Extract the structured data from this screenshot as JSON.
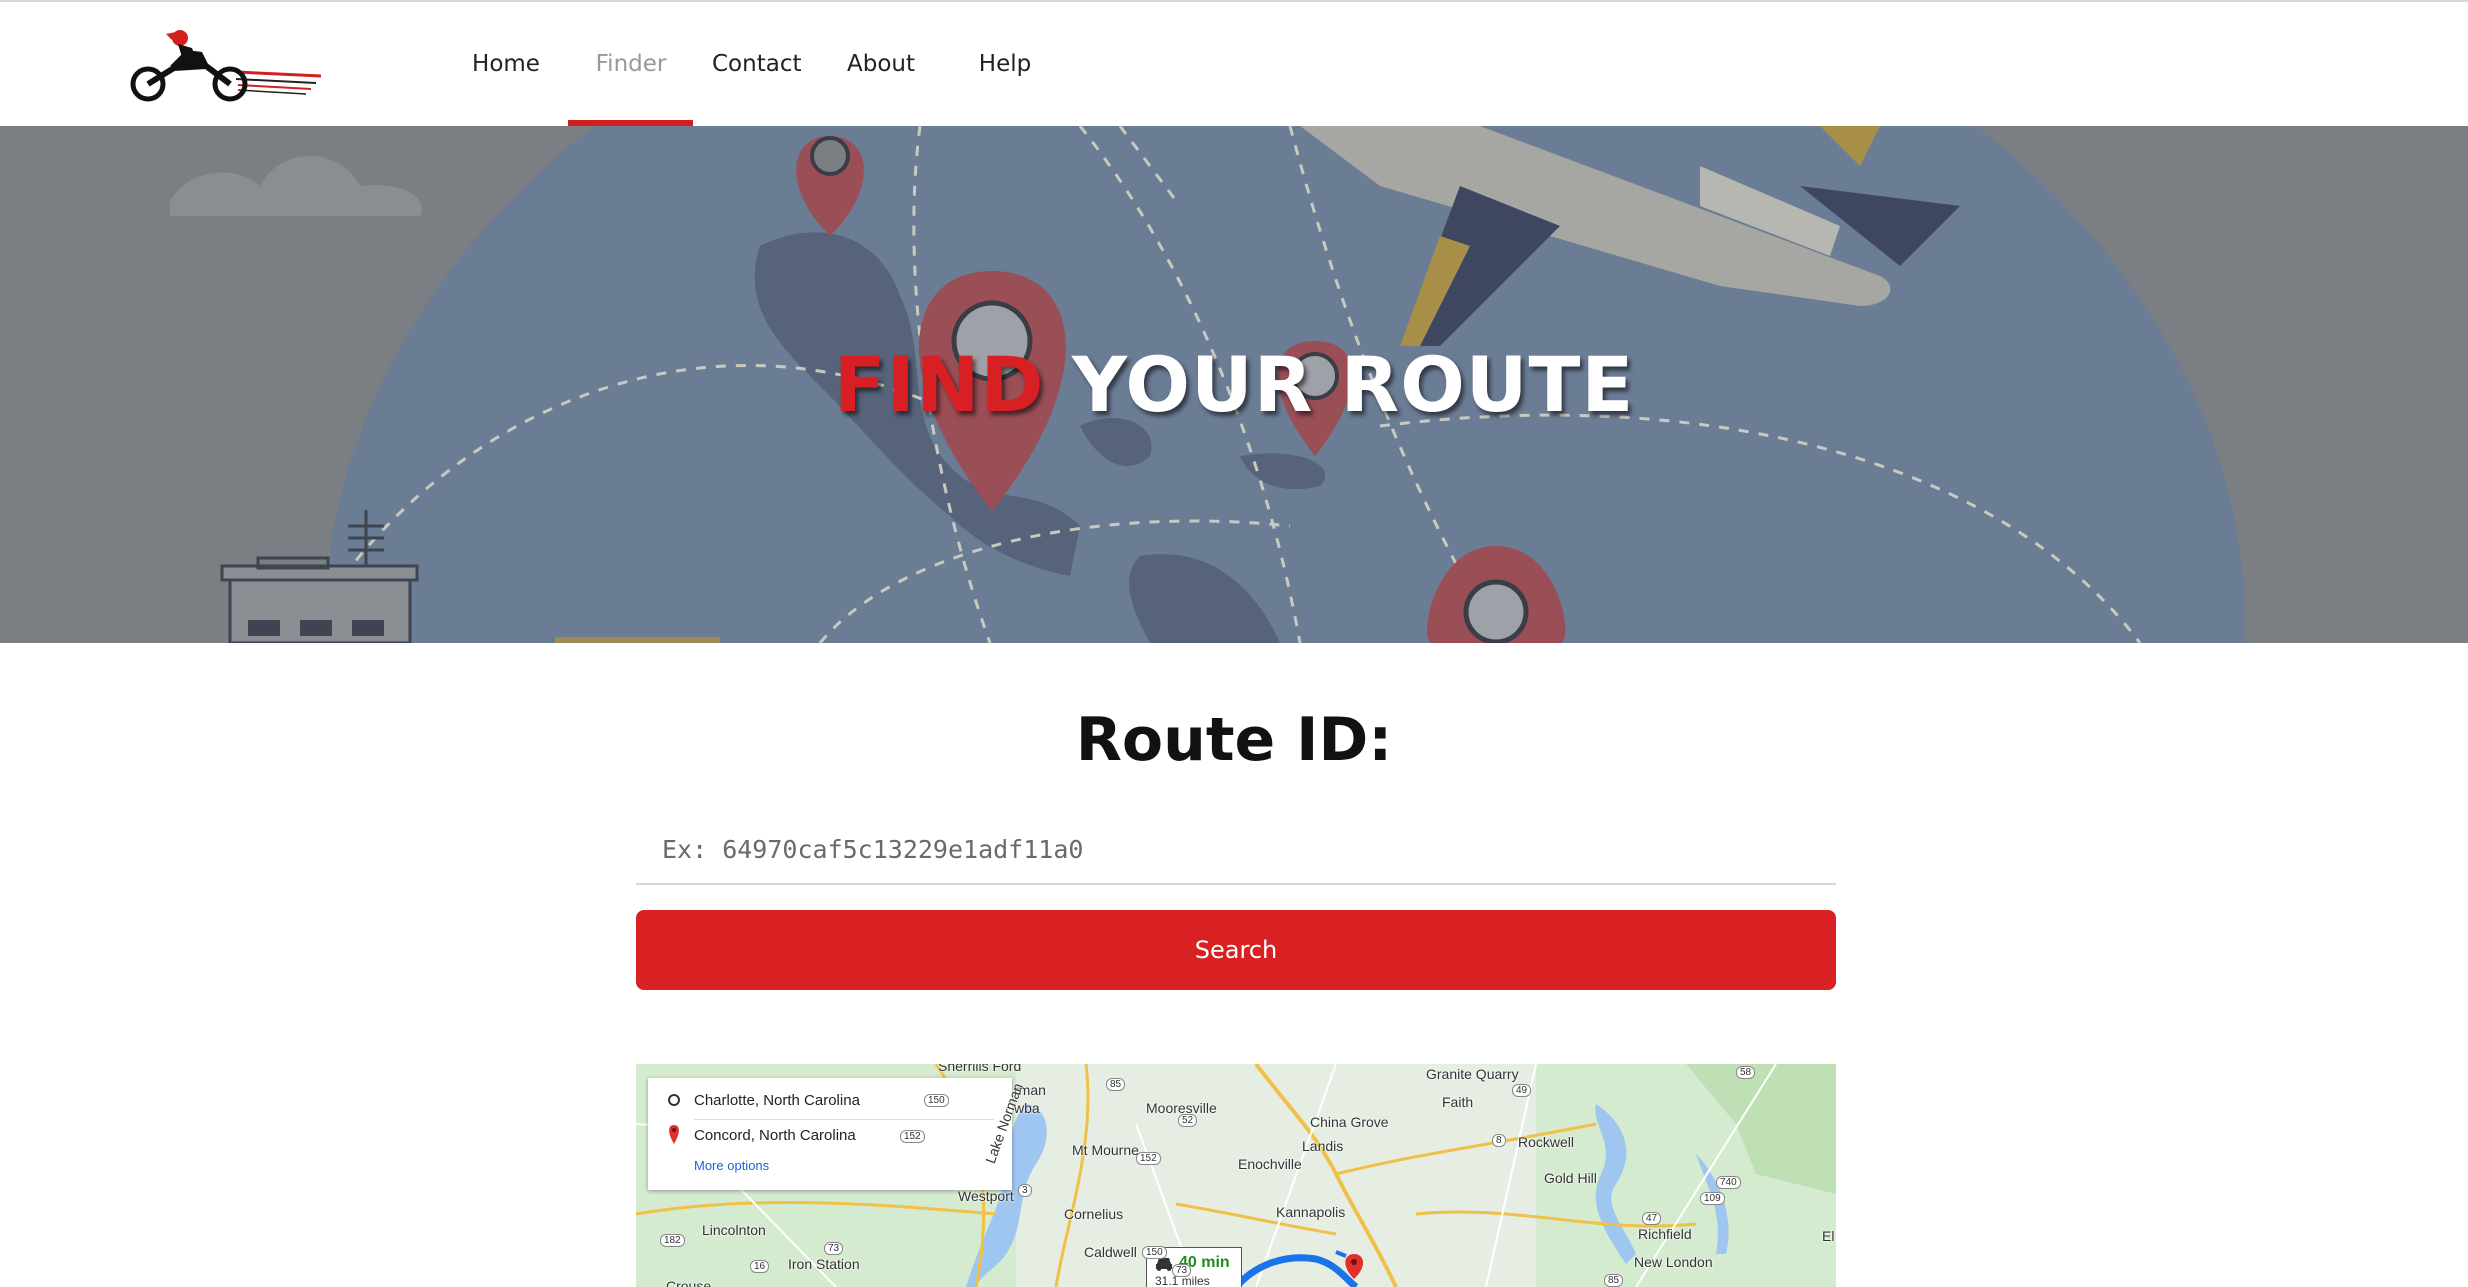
{
  "nav": {
    "items": [
      {
        "label": "Home"
      },
      {
        "label": "Finder"
      },
      {
        "label": "Contact"
      },
      {
        "label": "About"
      },
      {
        "label": "Help"
      }
    ],
    "active": "Finder"
  },
  "hero": {
    "title_accent": "FIND",
    "title_rest": " YOUR ROUTE"
  },
  "route": {
    "heading": "Route ID:",
    "placeholder": "Ex: 64970caf5c13229e1adf11a0",
    "search_label": "Search"
  },
  "map": {
    "origin": "Charlotte, North Carolina",
    "destination": "Concord, North Carolina",
    "more_options": "More options",
    "travel_time": "40 min",
    "distance": "31.1 miles",
    "places": [
      "Sherrills Ford",
      "rman",
      "wba",
      "Mooresville",
      "Mt Mourne",
      "Westport",
      "Cornelius",
      "Lincolnton",
      "Iron Station",
      "Caldwell",
      "China Grove",
      "Landis",
      "Enochville",
      "Kannapolis",
      "Granite Quarry",
      "Faith",
      "Rockwell",
      "Gold Hill",
      "Richfield",
      "New London",
      "Lake Norman",
      "Crouse",
      "El"
    ],
    "road_numbers": [
      "150",
      "152",
      "85",
      "52",
      "152",
      "3",
      "73",
      "16",
      "182",
      "150",
      "73",
      "8",
      "49",
      "109",
      "47",
      "740",
      "58",
      "85"
    ]
  },
  "colors": {
    "accent": "#d92124",
    "hero_title_accent": "#d81f24",
    "nav_underline": "#d41f1f",
    "link": "#1a66d6"
  }
}
